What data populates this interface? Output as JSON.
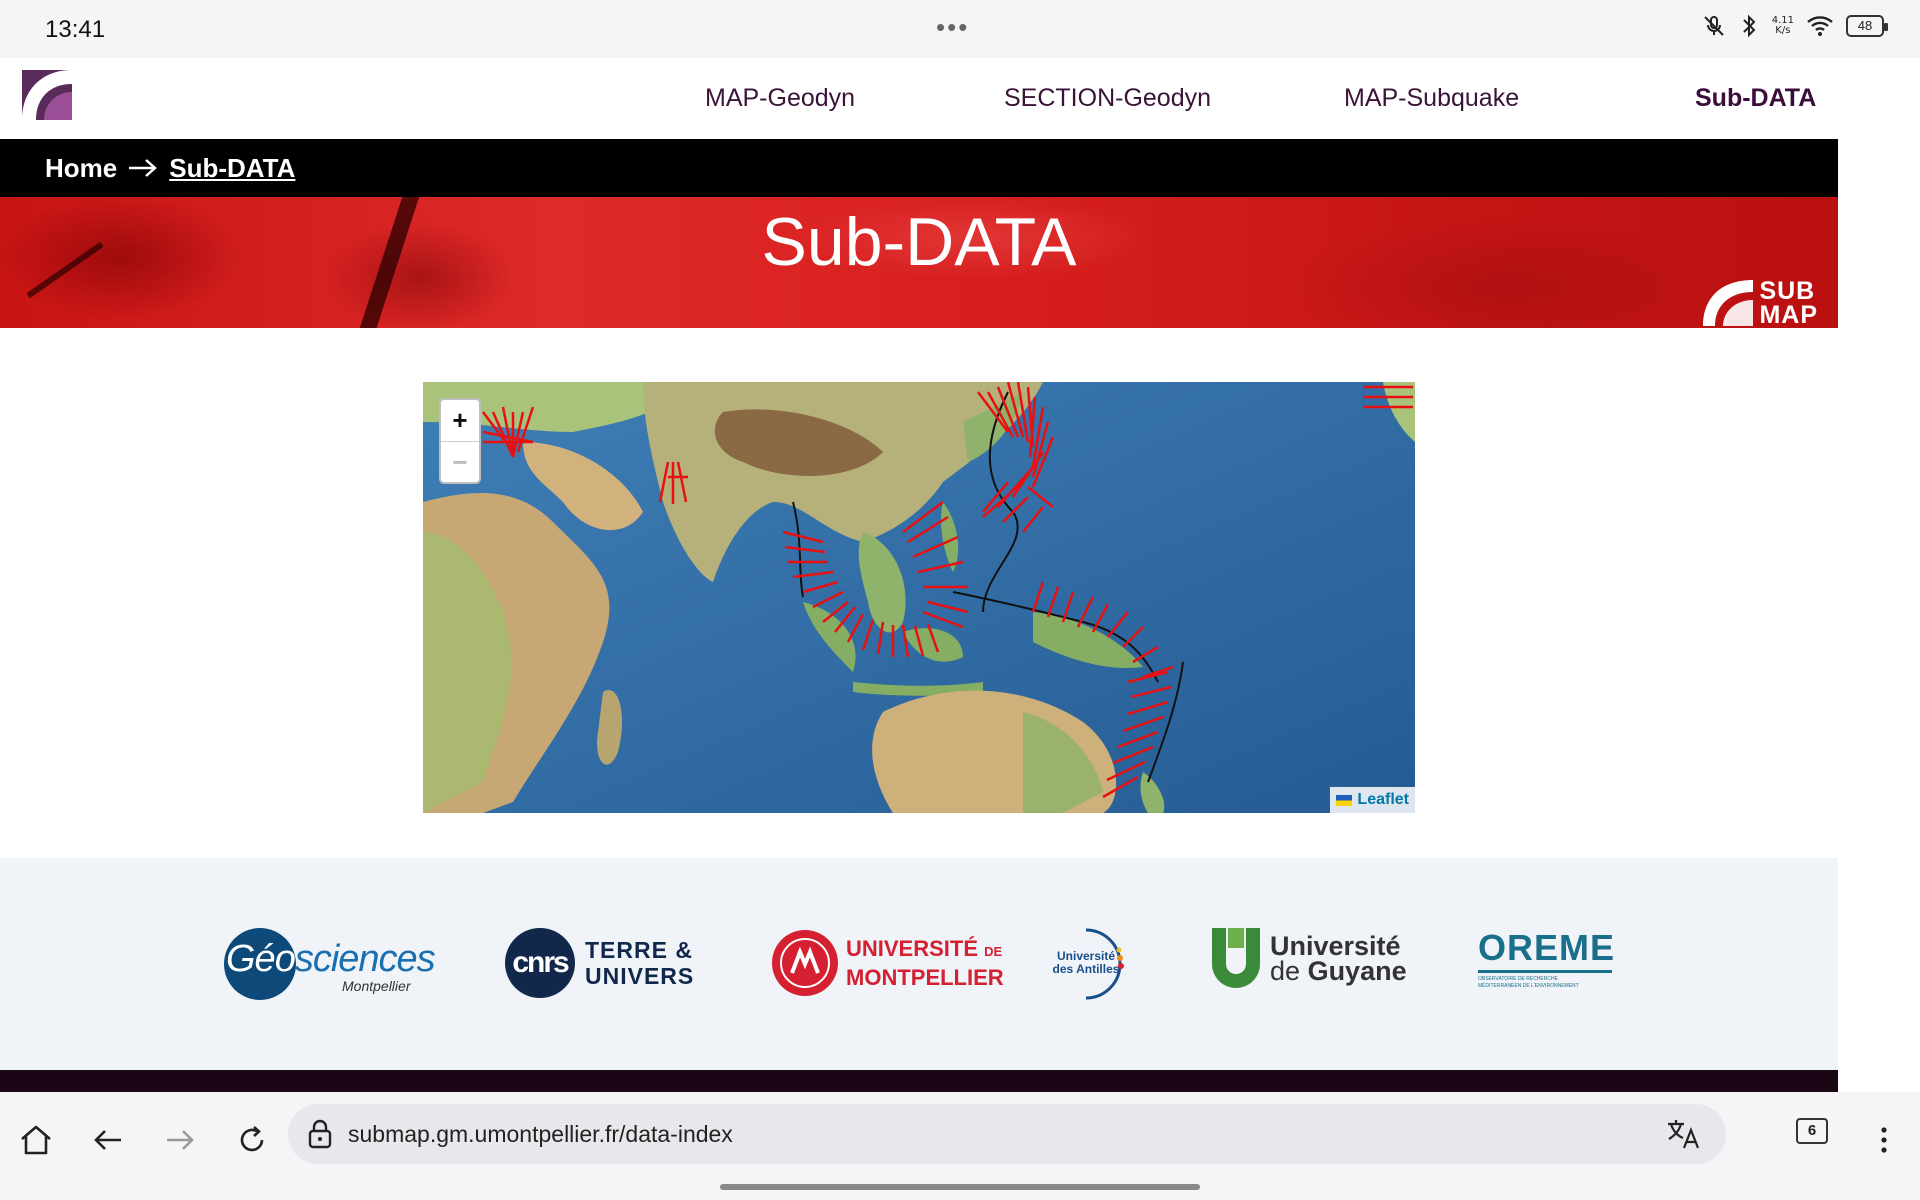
{
  "status_bar": {
    "time": "13:41",
    "net_speed_value": "4.11",
    "net_speed_unit": "K/s",
    "battery": "48"
  },
  "nav": {
    "items": [
      {
        "label": "MAP-Geodyn",
        "active": false
      },
      {
        "label": "SECTION-Geodyn",
        "active": false
      },
      {
        "label": "MAP-Subquake",
        "active": false
      },
      {
        "label": "Sub-DATA",
        "active": true
      }
    ]
  },
  "breadcrumb": {
    "home": "Home",
    "current": "Sub-DATA"
  },
  "banner": {
    "title": "Sub-DATA",
    "badge_line1": "SUB",
    "badge_line2": "MAP"
  },
  "map": {
    "zoom_in": "+",
    "zoom_out": "−",
    "attribution": "Leaflet"
  },
  "partners": {
    "geosciences": {
      "main1": "Géo",
      "main2": "sciences",
      "sub": "Montpellier"
    },
    "cnrs": {
      "logo": "cnrs",
      "line1": "TERRE &",
      "line2": "UNIVERS"
    },
    "montpellier": {
      "line1": "UNIVERSITÉ",
      "de": "DE",
      "line2": "MONTPELLIER"
    },
    "antilles": {
      "line1": "Université",
      "line2": "des Antilles"
    },
    "guyane": {
      "line1": "Université",
      "line2a": "de",
      "line2b": "Guyane"
    },
    "oreme": {
      "logo": "OREME",
      "sub1": "OBSERVATOIRE DE RECHERCHE",
      "sub2": "MÉDITERRANÉEN DE L'ENVIRONNEMENT"
    }
  },
  "browser": {
    "url": "submap.gm.umontpellier.fr/data-index",
    "tabs": "6"
  },
  "colors": {
    "brand_purple": "#3a0d3a",
    "banner_red": "#d71e1e",
    "breadcrumb_bg": "#000000",
    "partners_bg": "#f0f3f8",
    "leaflet_link": "#0078a8"
  }
}
